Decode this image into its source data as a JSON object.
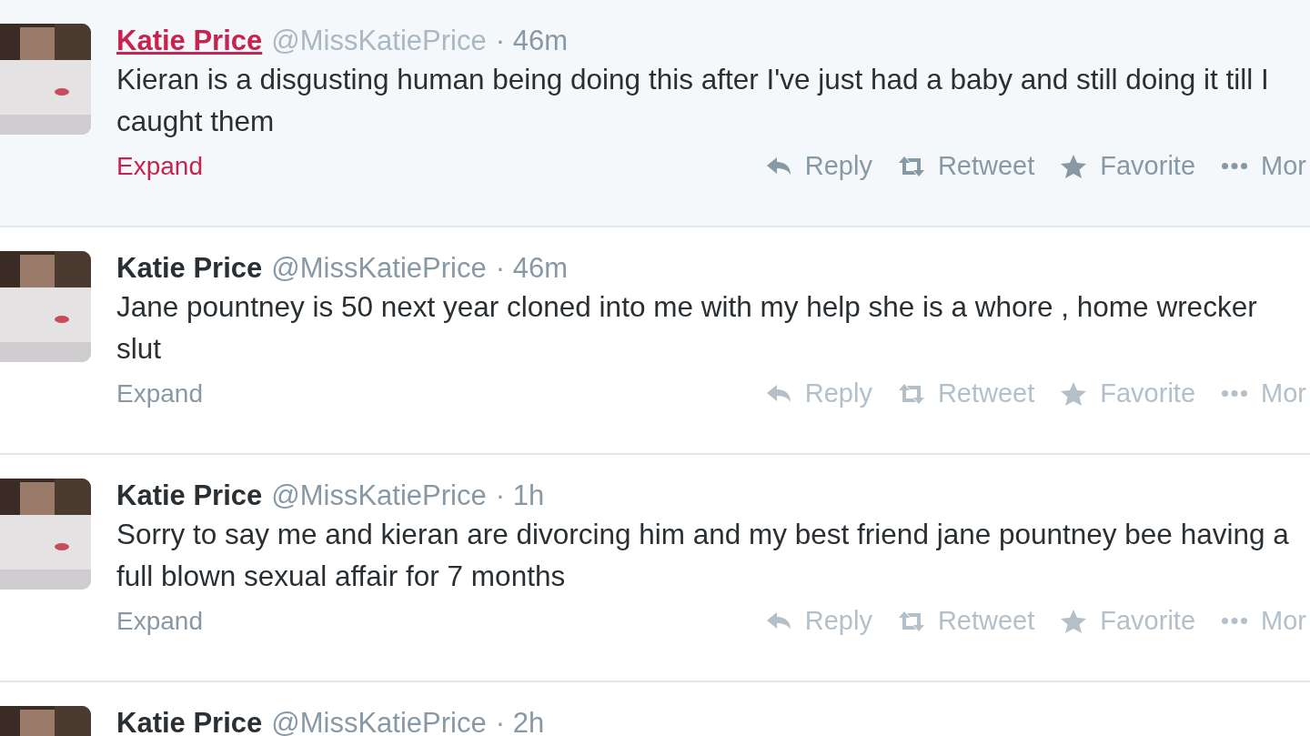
{
  "tweets": [
    {
      "name": "Katie Price",
      "handle": "@MissKatiePrice",
      "time": "· 46m",
      "hovered": true,
      "text": "Kieran is a disgusting human being doing this after I've just had a baby and still doing it till I caught them",
      "expand": "Expand",
      "actions": [
        {
          "kind": "reply",
          "label": "Reply"
        },
        {
          "kind": "retweet",
          "label": "Retweet"
        },
        {
          "kind": "favorite",
          "label": "Favorite"
        },
        {
          "kind": "more",
          "label": "Mor"
        }
      ]
    },
    {
      "name": "Katie Price",
      "handle": "@MissKatiePrice",
      "time": "· 46m",
      "hovered": false,
      "text": "Jane pountney is 50 next year cloned into me with my help she is a whore , home wrecker slut",
      "expand": "Expand",
      "actions": [
        {
          "kind": "reply",
          "label": "Reply"
        },
        {
          "kind": "retweet",
          "label": "Retweet"
        },
        {
          "kind": "favorite",
          "label": "Favorite"
        },
        {
          "kind": "more",
          "label": "Mor"
        }
      ]
    },
    {
      "name": "Katie Price",
      "handle": "@MissKatiePrice",
      "time": "· 1h",
      "hovered": false,
      "text": "Sorry to say me and kieran are divorcing him and my best friend jane pountney bee having a full blown sexual affair for 7 months",
      "expand": "Expand",
      "actions": [
        {
          "kind": "reply",
          "label": "Reply"
        },
        {
          "kind": "retweet",
          "label": "Retweet"
        },
        {
          "kind": "favorite",
          "label": "Favorite"
        },
        {
          "kind": "more",
          "label": "Mor"
        }
      ]
    },
    {
      "name": "Katie Price",
      "handle": "@MissKatiePrice",
      "time": "· 2h",
      "hovered": false
    }
  ]
}
